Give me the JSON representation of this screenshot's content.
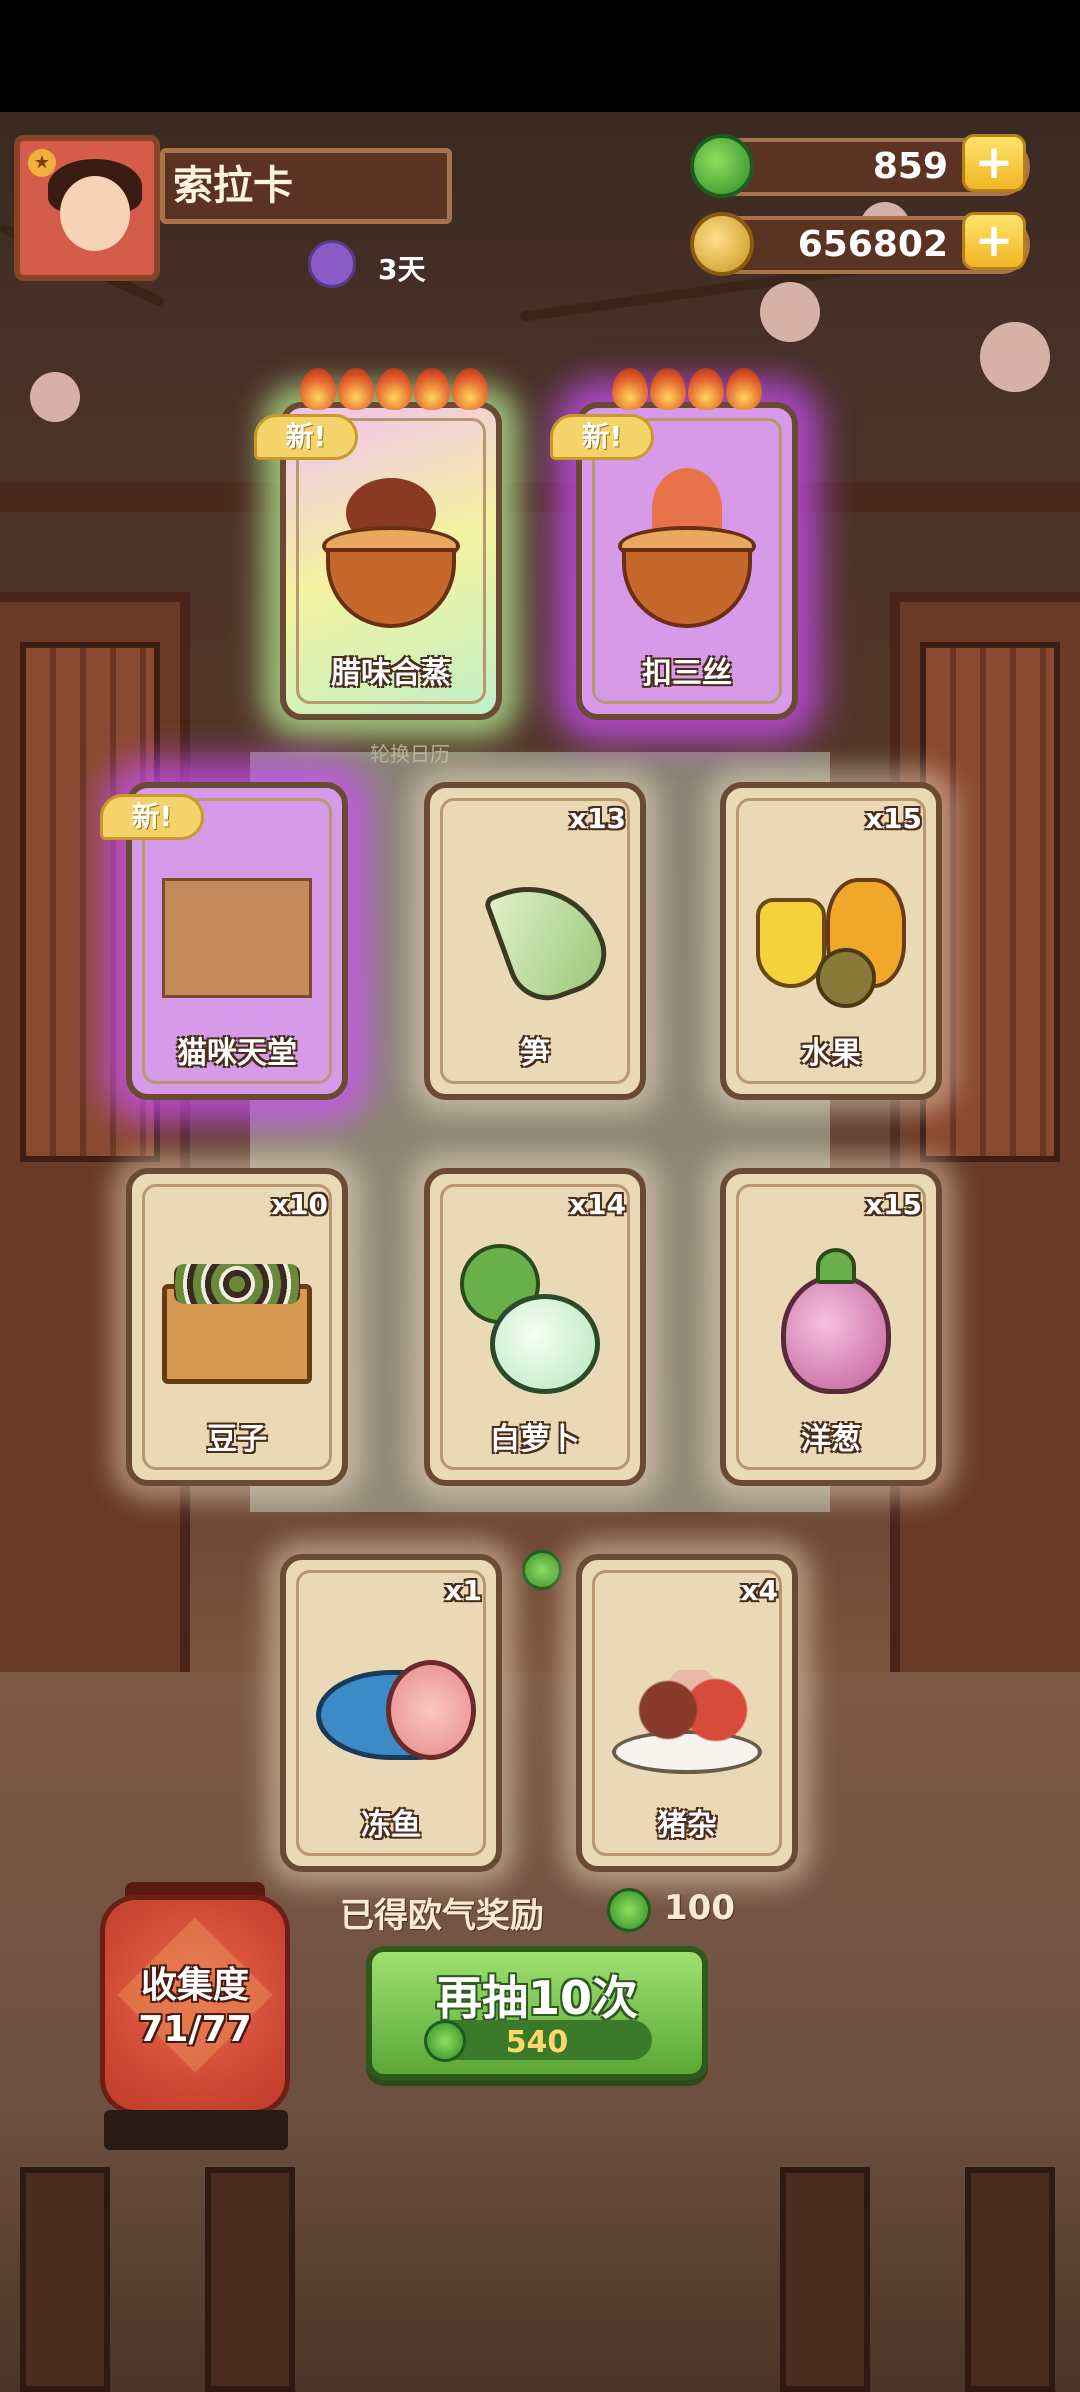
{
  "player": {
    "name": "索拉卡",
    "days": "3天"
  },
  "currency": {
    "jade": "859",
    "coins": "656802"
  },
  "background": {
    "calendar_label": "轮换日历"
  },
  "cards": [
    {
      "label": "腊味合蒸",
      "count": "",
      "new": true,
      "new_label": "新!",
      "flames": 5,
      "art": "cured-meat-dish",
      "rarity": "rainbow"
    },
    {
      "label": "扣三丝",
      "count": "",
      "new": true,
      "new_label": "新!",
      "flames": 4,
      "art": "noodle-bowl",
      "rarity": "purple"
    },
    {
      "label": "猫咪天堂",
      "count": "",
      "new": true,
      "new_label": "新!",
      "flames": 0,
      "art": "cat-room",
      "rarity": "purple"
    },
    {
      "label": "笋",
      "count": "x13",
      "new": false,
      "art": "bamboo-shoot",
      "rarity": "common"
    },
    {
      "label": "水果",
      "count": "x15",
      "new": false,
      "art": "fruit",
      "rarity": "common"
    },
    {
      "label": "豆子",
      "count": "x10",
      "new": false,
      "art": "beans",
      "rarity": "common"
    },
    {
      "label": "白萝卜",
      "count": "x14",
      "new": false,
      "art": "radish",
      "rarity": "common"
    },
    {
      "label": "洋葱",
      "count": "x15",
      "new": false,
      "art": "onion",
      "rarity": "common"
    },
    {
      "label": "冻鱼",
      "count": "x1",
      "new": false,
      "art": "frozen-fish",
      "rarity": "common"
    },
    {
      "label": "猪杂",
      "count": "x4",
      "new": false,
      "art": "pork-offal",
      "rarity": "common"
    }
  ],
  "reward": {
    "text": "已得欧气奖励",
    "amount": "100"
  },
  "collection": {
    "title": "收集度",
    "progress": "71/77"
  },
  "draw_button": {
    "label": "再抽10次",
    "cost": "540"
  },
  "colors": {
    "jade": "#2f8a2a",
    "gold": "#f0b624",
    "button_green": "#5aa836",
    "purple_glow": "#cd50ff"
  }
}
